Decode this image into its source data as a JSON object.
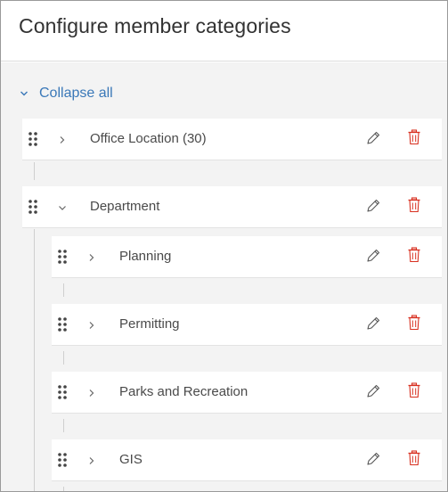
{
  "panel": {
    "title": "Configure member categories"
  },
  "toolbar": {
    "collapse_all_label": "Collapse all"
  },
  "categories": [
    {
      "label": "Office Location (30)",
      "expanded": false
    },
    {
      "label": "Department",
      "expanded": true,
      "children": [
        {
          "label": "Planning"
        },
        {
          "label": "Permitting"
        },
        {
          "label": "Parks and Recreation"
        },
        {
          "label": "GIS"
        }
      ]
    }
  ],
  "colors": {
    "accent": "#3a78b8",
    "delete": "#d83020",
    "background": "#f3f3f3"
  },
  "icons": {
    "drag": "drag-handle-icon",
    "expand": "chevron-right-icon",
    "collapse": "chevron-down-icon",
    "edit": "pencil-icon",
    "delete": "trash-icon"
  }
}
